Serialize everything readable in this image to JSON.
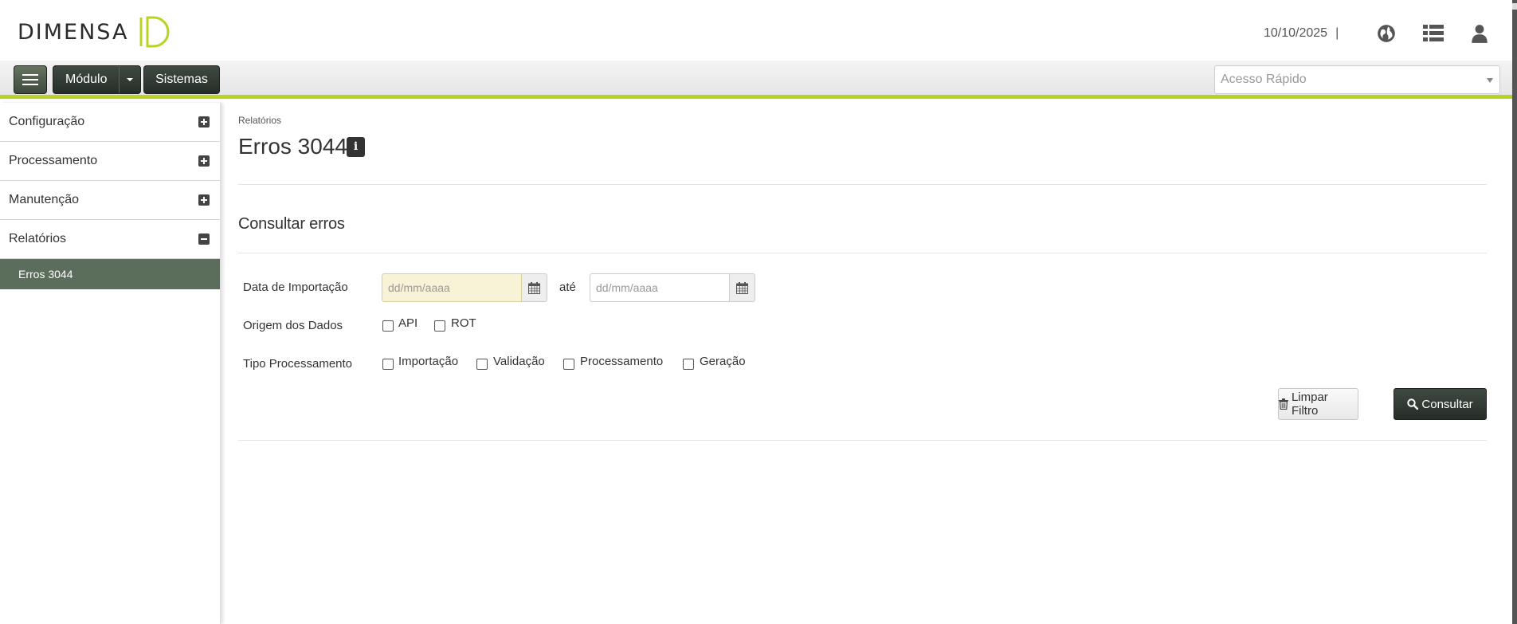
{
  "header": {
    "brand": "DIMENSA",
    "date": "10/10/2025",
    "separator": "|",
    "icons": [
      "globe-icon",
      "list-icon",
      "user-icon"
    ]
  },
  "toolbar": {
    "modulo_label": "Módulo",
    "sistemas_label": "Sistemas",
    "quick_access_placeholder": "Acesso Rápido"
  },
  "sidebar": {
    "items": [
      {
        "label": "Configuração",
        "state": "collapsed"
      },
      {
        "label": "Processamento",
        "state": "collapsed"
      },
      {
        "label": "Manutenção",
        "state": "collapsed"
      },
      {
        "label": "Relatórios",
        "state": "expanded"
      }
    ],
    "subitems": [
      {
        "label": "Erros 3044",
        "active": true
      }
    ]
  },
  "main": {
    "breadcrumb": "Relatórios",
    "title": "Erros 3044",
    "info_symbol": "i",
    "section_title": "Consultar erros",
    "form": {
      "date_label": "Data de Importação",
      "date_from_placeholder": "dd/mm/aaaa",
      "ate_label": "até",
      "date_to_placeholder": "dd/mm/aaaa",
      "origem_label": "Origem dos Dados",
      "origem_options": [
        "API",
        "ROT"
      ],
      "tipo_label": "Tipo Processamento",
      "tipo_options": [
        "Importação",
        "Validação",
        "Processamento",
        "Geração"
      ]
    },
    "buttons": {
      "clear": "Limpar Filtro",
      "search": "Consultar"
    }
  },
  "colors": {
    "accent": "#b9d224",
    "dark_button": "#2e3530",
    "active_sidebar": "#5b6e5c",
    "highlight_input": "#f8f3d7"
  }
}
